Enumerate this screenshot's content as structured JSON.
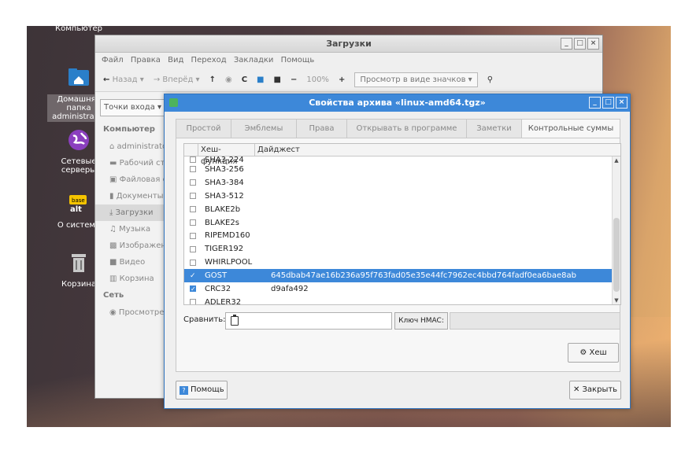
{
  "desktop": {
    "icons": [
      {
        "label": "Компьютер"
      },
      {
        "label": "Домашняя папка administrator"
      },
      {
        "label": "Сетевые серверы"
      },
      {
        "label": "О системе"
      },
      {
        "label": "Корзина"
      }
    ]
  },
  "file_manager": {
    "title": "Загрузки",
    "menu": [
      "Файл",
      "Правка",
      "Вид",
      "Переход",
      "Закладки",
      "Помощь"
    ],
    "toolbar": {
      "back_label": "Назад",
      "forward_label": "Вперёд",
      "zoom": "100%",
      "view_mode": "Просмотр в виде значков"
    },
    "places_combo": "Точки входа",
    "sidebar": {
      "computer_header": "Компьютер",
      "items": [
        "administrator",
        "Рабочий стол",
        "Файловая система",
        "Документы",
        "Загрузки",
        "Музыка",
        "Изображения",
        "Видео",
        "Корзина"
      ],
      "network_header": "Сеть",
      "network_items": [
        "Просмотреть сеть"
      ]
    }
  },
  "dialog": {
    "title": "Свойства архива «linux-amd64.tgz»",
    "tabs": [
      "Простой",
      "Эмблемы",
      "Права",
      "Открывать в программе",
      "Заметки",
      "Контрольные суммы"
    ],
    "active_tab": "Контрольные суммы",
    "list": {
      "columns": [
        "Хеш-функция",
        "Дайджест"
      ],
      "rows": [
        {
          "name": "SHA3-224",
          "digest": "",
          "checked": false,
          "cut": true
        },
        {
          "name": "SHA3-256",
          "digest": "",
          "checked": false
        },
        {
          "name": "SHA3-384",
          "digest": "",
          "checked": false
        },
        {
          "name": "SHA3-512",
          "digest": "",
          "checked": false
        },
        {
          "name": "BLAKE2b",
          "digest": "",
          "checked": false
        },
        {
          "name": "BLAKE2s",
          "digest": "",
          "checked": false
        },
        {
          "name": "RIPEMD160",
          "digest": "",
          "checked": false
        },
        {
          "name": "TIGER192",
          "digest": "",
          "checked": false
        },
        {
          "name": "WHIRLPOOL",
          "digest": "",
          "checked": false
        },
        {
          "name": "GOST",
          "digest": "645dbab47ae16b236a95f763fad05e35e44fc7962ec4bbd764fadf0ea6bae8ab",
          "checked": true,
          "selected": true
        },
        {
          "name": "CRC32",
          "digest": "d9afa492",
          "checked": true
        },
        {
          "name": "ADLER32",
          "digest": "",
          "checked": false
        }
      ]
    },
    "compare_label": "Сравнить:",
    "hmac_button": "Ключ HMAC:",
    "hash_button": "Хеш",
    "help_button": "Помощь",
    "close_button": "Закрыть",
    "colors": {
      "accent": "#3d88d9"
    }
  }
}
